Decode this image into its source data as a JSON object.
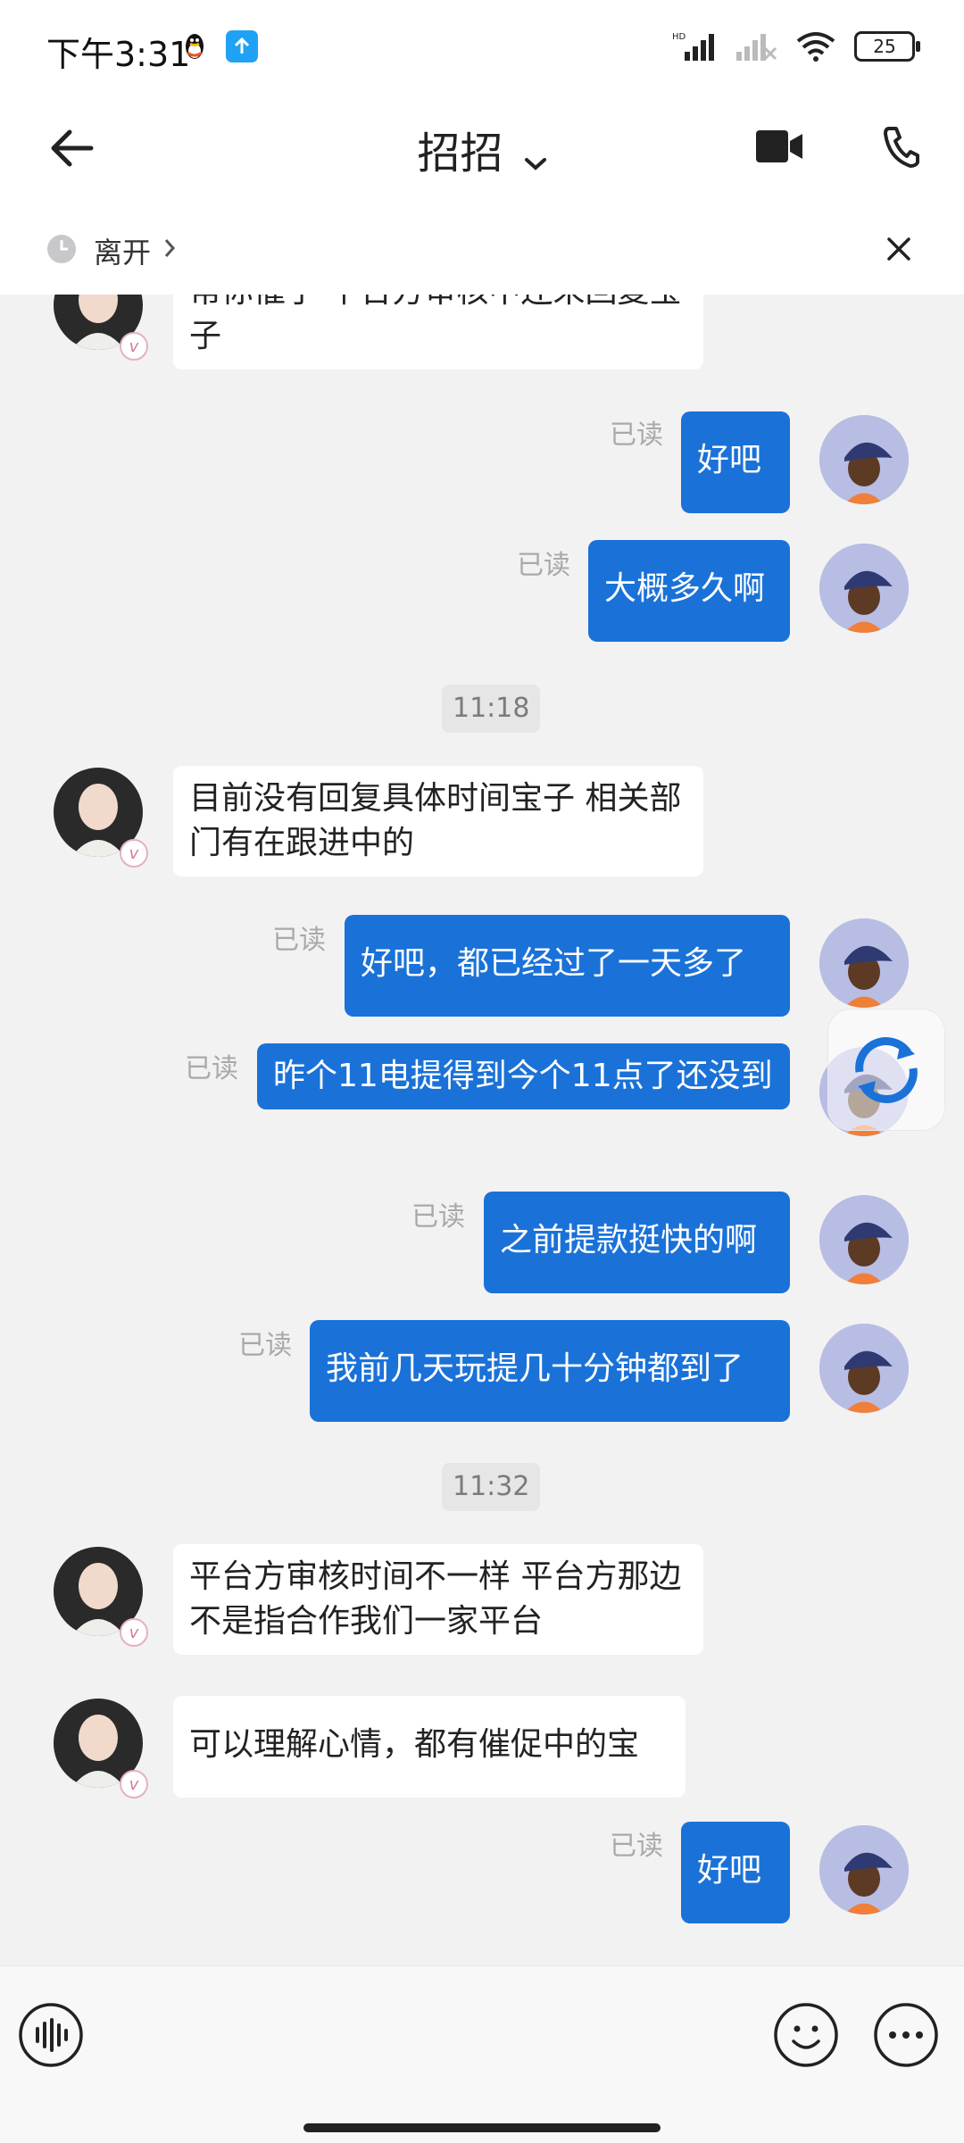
{
  "status_bar": {
    "time": "下午3:31",
    "battery": "25",
    "network_label": "HD"
  },
  "header": {
    "title": "招招"
  },
  "notice": {
    "label": "离开"
  },
  "read_label": "已读",
  "messages": [
    {
      "side": "in",
      "text": "帮你催了 平台方审核中还未回复宝子"
    },
    {
      "side": "out",
      "text": "好吧"
    },
    {
      "side": "out",
      "text": "大概多久啊"
    },
    {
      "type": "time",
      "text": "11:18"
    },
    {
      "side": "in",
      "text": "目前没有回复具体时间宝子 相关部门有在跟进中的"
    },
    {
      "side": "out",
      "text": "好吧，都已经过了一天多了"
    },
    {
      "side": "out",
      "text": "昨个11电提得到今个11点了还没到"
    },
    {
      "side": "out",
      "text": "之前提款挺快的啊"
    },
    {
      "side": "out",
      "text": "我前几天玩提几十分钟都到了"
    },
    {
      "type": "time",
      "text": "11:32"
    },
    {
      "side": "in",
      "text": "平台方审核时间不一样 平台方那边不是指合作我们一家平台"
    },
    {
      "side": "in",
      "text": "可以理解心情，都有催促中的宝"
    },
    {
      "side": "out",
      "text": "好吧"
    }
  ],
  "icons": {
    "back": "arrow-left-icon",
    "video": "video-camera-icon",
    "phone": "phone-icon",
    "clock": "clock-icon",
    "close": "close-icon",
    "voice": "voice-wave-icon",
    "emoji": "smiley-icon",
    "more": "more-dots-icon",
    "refresh": "refresh-icon"
  },
  "colors": {
    "outgoing_bubble": "#1a72d8",
    "incoming_bubble": "#ffffff",
    "background": "#f2f2f3"
  }
}
